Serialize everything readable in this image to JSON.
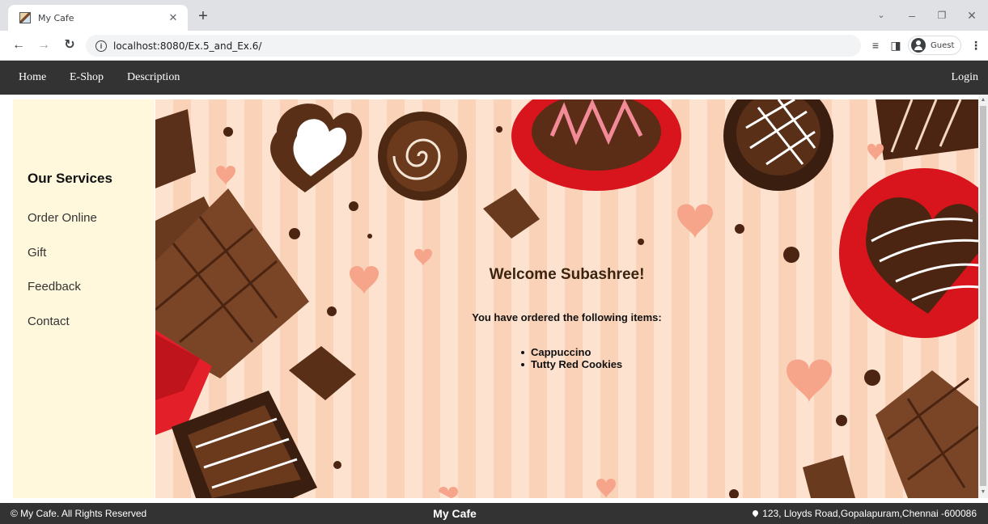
{
  "browser": {
    "tab_title": "My Cafe",
    "url": "localhost:8080/Ex.5_and_Ex.6/",
    "profile_label": "Guest"
  },
  "navbar": {
    "links": [
      "Home",
      "E-Shop",
      "Description"
    ],
    "login_label": "Login"
  },
  "sidebar": {
    "heading": "Our Services",
    "items": [
      "Order Online",
      "Gift",
      "Feedback",
      "Contact"
    ]
  },
  "main": {
    "welcome": "Welcome Subashree!",
    "ordered_intro": "You have ordered the following items:",
    "items": [
      "Cappuccino",
      "Tutty Red Cookies"
    ]
  },
  "footer": {
    "copyright": "© My Cafe. All Rights Reserved",
    "brand": "My Cafe",
    "address": "123, Lloyds Road,Gopalapuram,Chennai -600086"
  },
  "colors": {
    "nav_bg": "#333333",
    "sidebar_bg": "#fff8dc",
    "welcome_text": "#3b2410"
  }
}
